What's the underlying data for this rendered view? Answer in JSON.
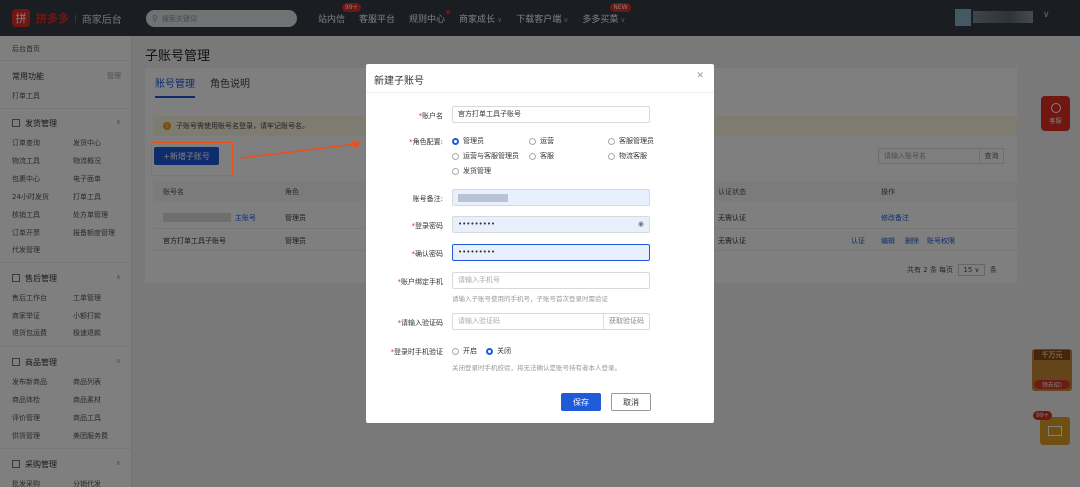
{
  "header": {
    "logo_icon": "拼",
    "brand": "拼多多",
    "subtitle": "商家后台",
    "search_placeholder": "搜索关键词",
    "nav": [
      {
        "label": "站内信",
        "badge": "99+"
      },
      {
        "label": "客服平台"
      },
      {
        "label": "规则中心"
      },
      {
        "label": "商家成长"
      },
      {
        "label": "下载客户端"
      },
      {
        "label": "多多买菜",
        "badge": "NEW"
      }
    ]
  },
  "sidebar": {
    "home": "后台首页",
    "common": {
      "title": "常用功能",
      "manage": "管理",
      "item": "打单工具"
    },
    "groups": [
      {
        "title": "发货管理",
        "items": [
          "订单查询",
          "发货中心",
          "物流工具",
          "物流概况",
          "包裹中心",
          "电子面单",
          "24小时发货",
          "打单工具",
          "核销工具",
          "处方单管理",
          "订单开票",
          "报备额度管理",
          "代发管理"
        ]
      },
      {
        "title": "售后管理",
        "items": [
          "售后工作台",
          "工单管理",
          "商家举证",
          "小额打款",
          "退货包运费",
          "极速退款"
        ]
      },
      {
        "title": "商品管理",
        "items": [
          "发布新商品",
          "商品列表",
          "商品体检",
          "商品素材",
          "评价管理",
          "商品工具",
          "供货管理",
          "美团服务费"
        ]
      },
      {
        "title": "采购管理",
        "items": [
          "批发采购",
          "分销代发"
        ]
      }
    ]
  },
  "page": {
    "title": "子账号管理",
    "tabs": [
      "账号管理",
      "角色说明"
    ],
    "notice": "子账号需使用账号名登录，请牢记账号名。",
    "add_button": "+新增子账号",
    "search_placeholder": "请输入账号名",
    "search_button": "查询",
    "columns": [
      "账号名",
      "角色",
      "认证状态",
      "操作"
    ],
    "rows": [
      {
        "name": "",
        "suffix": "主账号",
        "role": "管理员",
        "auth": "无需认证",
        "actions": [
          "修改备注"
        ]
      },
      {
        "name": "官方打单工具子账号",
        "suffix": "",
        "role": "管理员",
        "auth": "无需认证",
        "cert": "认证",
        "actions": [
          "编辑",
          "删除",
          "账号权限"
        ]
      }
    ],
    "pager": {
      "total_prefix": "共有",
      "total": "2",
      "total_suffix": "条",
      "per_page_label": "每页",
      "per_page": "15",
      "per_page_unit": "条"
    }
  },
  "modal": {
    "title": "新建子账号",
    "fields": {
      "account_label": "账户名",
      "account_value": "官方打单工具子账号",
      "role_label": "角色配置:",
      "roles": [
        "管理员",
        "运营",
        "客服管理员",
        "运营与客服管理员",
        "客服",
        "物流客服",
        "发货管理"
      ],
      "note_label": "账号备注:",
      "password_label": "登录密码",
      "password_value": "•••••••••",
      "confirm_label": "确认密码",
      "confirm_value": "•••••••••",
      "phone_label": "账户绑定手机",
      "phone_placeholder": "请输入手机号",
      "phone_hint": "请输入子账号使用的手机号，子账号首次登录时需验证",
      "code_label": "请输入验证码",
      "code_placeholder": "请输入验证码",
      "code_button": "获取验证码",
      "verify_label": "登录时手机验证",
      "verify_on": "开启",
      "verify_off": "关闭",
      "verify_hint": "关闭登录时手机校验，将无法确认是账号持有者本人登录。"
    },
    "save": "保存",
    "cancel": "取消"
  },
  "floats": {
    "cs_label": "客服",
    "promo_title": "千万元",
    "promo_sub": "领去招!",
    "mail_badge": "99+"
  }
}
